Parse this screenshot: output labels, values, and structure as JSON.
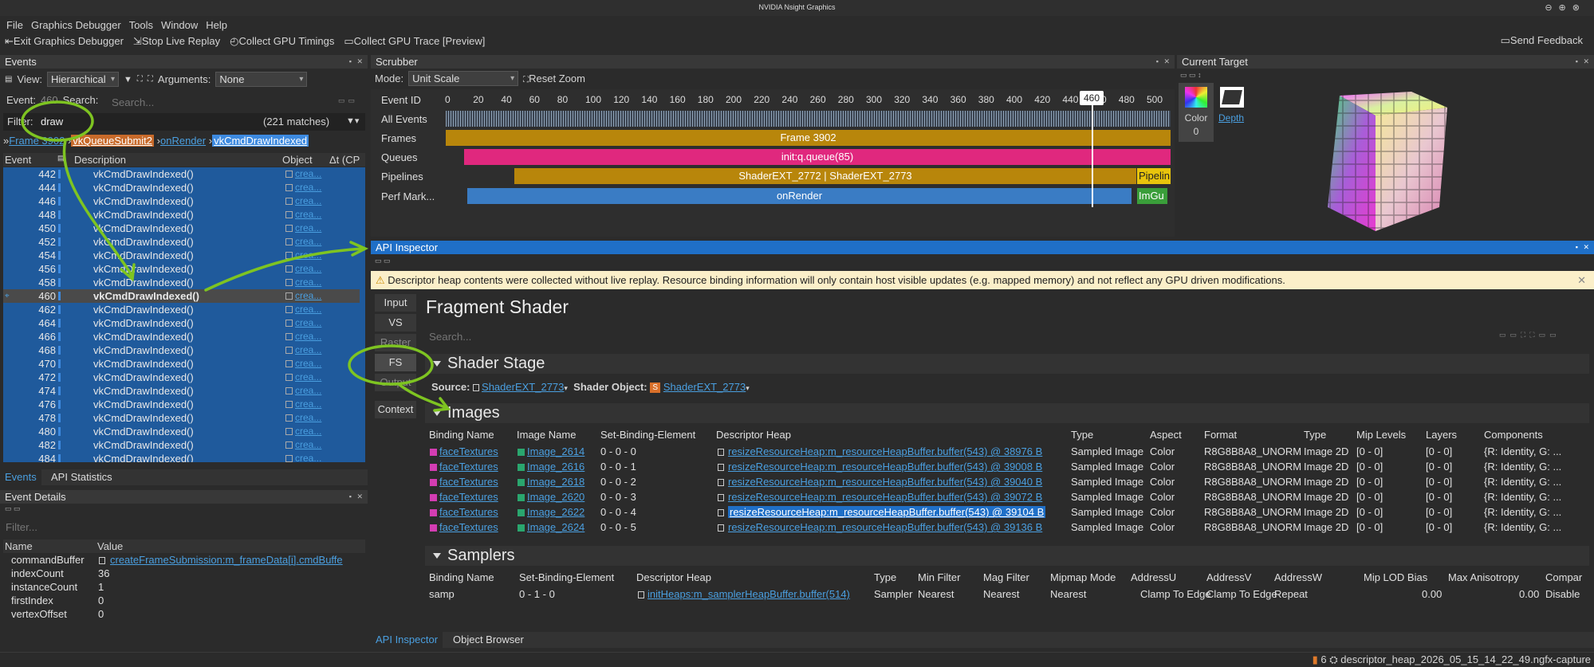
{
  "window_title": "NVIDIA Nsight Graphics",
  "menu": [
    "File",
    "Graphics Debugger",
    "Tools",
    "Window",
    "Help"
  ],
  "toolbar": {
    "exit": "Exit Graphics Debugger",
    "stop": "Stop Live Replay",
    "collect_timings": "Collect GPU Timings",
    "collect_trace": "Collect GPU Trace [Preview]",
    "feedback": "Send Feedback"
  },
  "events_panel": {
    "title": "Events",
    "view_label": "View:",
    "view_value": "Hierarchical",
    "arguments_label": "Arguments:",
    "arguments_value": "None",
    "event_label": "Event:",
    "event_value": "460",
    "search_label": "Search:",
    "search_placeholder": "Search...",
    "filter_label": "Filter:",
    "filter_value": "draw",
    "matches": "(221 matches)",
    "breadcrumb": [
      "Frame 3902",
      "vkQueueSubmit2",
      "onRender",
      "vkCmdDrawIndexed"
    ],
    "columns": [
      "Event",
      "Description",
      "Object",
      "Δt (CP"
    ],
    "rows": [
      {
        "num": "442",
        "desc": "vkCmdDrawIndexed()",
        "obj": "crea..."
      },
      {
        "num": "444",
        "desc": "vkCmdDrawIndexed()",
        "obj": "crea..."
      },
      {
        "num": "446",
        "desc": "vkCmdDrawIndexed()",
        "obj": "crea..."
      },
      {
        "num": "448",
        "desc": "vkCmdDrawIndexed()",
        "obj": "crea..."
      },
      {
        "num": "450",
        "desc": "vkCmdDrawIndexed()",
        "obj": "crea..."
      },
      {
        "num": "452",
        "desc": "vkCmdDrawIndexed()",
        "obj": "crea..."
      },
      {
        "num": "454",
        "desc": "vkCmdDrawIndexed()",
        "obj": "crea..."
      },
      {
        "num": "456",
        "desc": "vkCmdDrawIndexed()",
        "obj": "crea..."
      },
      {
        "num": "458",
        "desc": "vkCmdDrawIndexed()",
        "obj": "crea..."
      },
      {
        "num": "460",
        "desc": "vkCmdDrawIndexed()",
        "obj": "crea..."
      },
      {
        "num": "462",
        "desc": "vkCmdDrawIndexed()",
        "obj": "crea..."
      },
      {
        "num": "464",
        "desc": "vkCmdDrawIndexed()",
        "obj": "crea..."
      },
      {
        "num": "466",
        "desc": "vkCmdDrawIndexed()",
        "obj": "crea..."
      },
      {
        "num": "468",
        "desc": "vkCmdDrawIndexed()",
        "obj": "crea..."
      },
      {
        "num": "470",
        "desc": "vkCmdDrawIndexed()",
        "obj": "crea..."
      },
      {
        "num": "472",
        "desc": "vkCmdDrawIndexed()",
        "obj": "crea..."
      },
      {
        "num": "474",
        "desc": "vkCmdDrawIndexed()",
        "obj": "crea..."
      },
      {
        "num": "476",
        "desc": "vkCmdDrawIndexed()",
        "obj": "crea..."
      },
      {
        "num": "478",
        "desc": "vkCmdDrawIndexed()",
        "obj": "crea..."
      },
      {
        "num": "480",
        "desc": "vkCmdDrawIndexed()",
        "obj": "crea..."
      },
      {
        "num": "482",
        "desc": "vkCmdDrawIndexed()",
        "obj": "crea..."
      },
      {
        "num": "484",
        "desc": "vkCmdDrawIndexed()",
        "obj": "crea..."
      }
    ],
    "tabs": [
      "Events",
      "API Statistics"
    ]
  },
  "event_details": {
    "title": "Event Details",
    "filter_placeholder": "Filter...",
    "columns": [
      "Name",
      "Value"
    ],
    "rows": [
      {
        "name": "commandBuffer",
        "value": "createFrameSubmission:m_frameData[i].cmdBuffe"
      },
      {
        "name": "indexCount",
        "value": "36"
      },
      {
        "name": "instanceCount",
        "value": "1"
      },
      {
        "name": "firstIndex",
        "value": "0"
      },
      {
        "name": "vertexOffset",
        "value": "0"
      }
    ]
  },
  "scrubber": {
    "title": "Scrubber",
    "mode_label": "Mode:",
    "mode_value": "Unit Scale",
    "reset_zoom": "Reset Zoom",
    "ticks": [
      "0",
      "20",
      "40",
      "60",
      "80",
      "100",
      "120",
      "140",
      "160",
      "180",
      "200",
      "220",
      "240",
      "260",
      "280",
      "300",
      "320",
      "340",
      "360",
      "380",
      "400",
      "420",
      "440",
      "460",
      "480",
      "500"
    ],
    "current_event": "460",
    "lanes": {
      "event_id": "Event ID",
      "all_events": "All Events",
      "frames": "Frames",
      "queues": "Queues",
      "pipelines": "Pipelines",
      "perf_markers": "Perf Mark..."
    },
    "frame_bar": "Frame 3902",
    "queue_bar": "init:q.queue(85)",
    "pipeline_bar": "ShaderEXT_2772 | ShaderEXT_2773",
    "pipeline_bar2": "Pipelin",
    "perf_bar": "onRender",
    "perf_bar2": "ImGu"
  },
  "current_target": {
    "title": "Current Target",
    "color_label": "Color",
    "color_index": "0",
    "depth_label": "Depth"
  },
  "api_inspector": {
    "title": "API Inspector",
    "warning": "Descriptor heap contents were collected without live replay. Resource binding information will only contain host visible updates (e.g. mapped memory) and not reflect any GPU driven modifications.",
    "stages": [
      "Input",
      "VS",
      "Raster",
      "FS",
      "Output",
      "Context"
    ],
    "heading": "Fragment Shader",
    "search_placeholder": "Search...",
    "shader_stage_title": "Shader Stage",
    "source_label": "Source:",
    "source_value": "ShaderEXT_2773",
    "shader_object_label": "Shader Object:",
    "shader_object_value": "ShaderEXT_2773",
    "images_title": "Images",
    "images_columns": [
      "Binding Name",
      "Image Name",
      "Set-Binding-Element",
      "Descriptor Heap",
      "Type",
      "Aspect",
      "Format",
      "Type",
      "Mip Levels",
      "Layers",
      "Components"
    ],
    "images_rows": [
      {
        "binding": "faceTextures",
        "image": "Image_2614",
        "sbe": "0 - 0 - 0",
        "heap": "resizeResourceHeap:m_resourceHeapBuffer.buffer(543) @ 38976 B",
        "type": "Sampled Image",
        "aspect": "Color",
        "format": "R8G8B8A8_UNORM",
        "type2": "Image 2D",
        "mips": "[0 - 0]",
        "layers": "[0 - 0]",
        "components": "{R: Identity, G: ..."
      },
      {
        "binding": "faceTextures",
        "image": "Image_2616",
        "sbe": "0 - 0 - 1",
        "heap": "resizeResourceHeap:m_resourceHeapBuffer.buffer(543) @ 39008 B",
        "type": "Sampled Image",
        "aspect": "Color",
        "format": "R8G8B8A8_UNORM",
        "type2": "Image 2D",
        "mips": "[0 - 0]",
        "layers": "[0 - 0]",
        "components": "{R: Identity, G: ..."
      },
      {
        "binding": "faceTextures",
        "image": "Image_2618",
        "sbe": "0 - 0 - 2",
        "heap": "resizeResourceHeap:m_resourceHeapBuffer.buffer(543) @ 39040 B",
        "type": "Sampled Image",
        "aspect": "Color",
        "format": "R8G8B8A8_UNORM",
        "type2": "Image 2D",
        "mips": "[0 - 0]",
        "layers": "[0 - 0]",
        "components": "{R: Identity, G: ..."
      },
      {
        "binding": "faceTextures",
        "image": "Image_2620",
        "sbe": "0 - 0 - 3",
        "heap": "resizeResourceHeap:m_resourceHeapBuffer.buffer(543) @ 39072 B",
        "type": "Sampled Image",
        "aspect": "Color",
        "format": "R8G8B8A8_UNORM",
        "type2": "Image 2D",
        "mips": "[0 - 0]",
        "layers": "[0 - 0]",
        "components": "{R: Identity, G: ..."
      },
      {
        "binding": "faceTextures",
        "image": "Image_2622",
        "sbe": "0 - 0 - 4",
        "heap": "resizeResourceHeap:m_resourceHeapBuffer.buffer(543) @ 39104 B",
        "type": "Sampled Image",
        "aspect": "Color",
        "format": "R8G8B8A8_UNORM",
        "type2": "Image 2D",
        "mips": "[0 - 0]",
        "layers": "[0 - 0]",
        "components": "{R: Identity, G: ..."
      },
      {
        "binding": "faceTextures",
        "image": "Image_2624",
        "sbe": "0 - 0 - 5",
        "heap": "resizeResourceHeap:m_resourceHeapBuffer.buffer(543) @ 39136 B",
        "type": "Sampled Image",
        "aspect": "Color",
        "format": "R8G8B8A8_UNORM",
        "type2": "Image 2D",
        "mips": "[0 - 0]",
        "layers": "[0 - 0]",
        "components": "{R: Identity, G: ..."
      }
    ],
    "samplers_title": "Samplers",
    "samplers_columns": [
      "Binding Name",
      "Set-Binding-Element",
      "Descriptor Heap",
      "Type",
      "Min Filter",
      "Mag Filter",
      "Mipmap Mode",
      "AddressU",
      "AddressV",
      "AddressW",
      "Mip LOD Bias",
      "Max Anisotropy",
      "Compar"
    ],
    "samplers_row": {
      "binding": "samp",
      "sbe": "0 - 1 - 0",
      "heap": "initHeaps:m_samplerHeapBuffer.buffer(514)",
      "type": "Sampler",
      "min": "Nearest",
      "mag": "Nearest",
      "mip": "Nearest",
      "u": "Clamp To Edge",
      "v": "Clamp To Edge",
      "w": "Repeat",
      "bias": "0.00",
      "aniso": "0.00",
      "compare": "Disable"
    },
    "tabs": [
      "API Inspector",
      "Object Browser"
    ]
  },
  "status": {
    "count": "6",
    "file": "descriptor_heap_2026_05_15_14_22_49.ngfx-capture"
  },
  "colors": {
    "accent": "#3d8ae0",
    "frames_bar": "#b8860b",
    "queue_bar": "#e0287e",
    "perf_bar": "#3a7cc4",
    "annotation": "#7ec421",
    "warning_bg": "#fbefc9"
  }
}
